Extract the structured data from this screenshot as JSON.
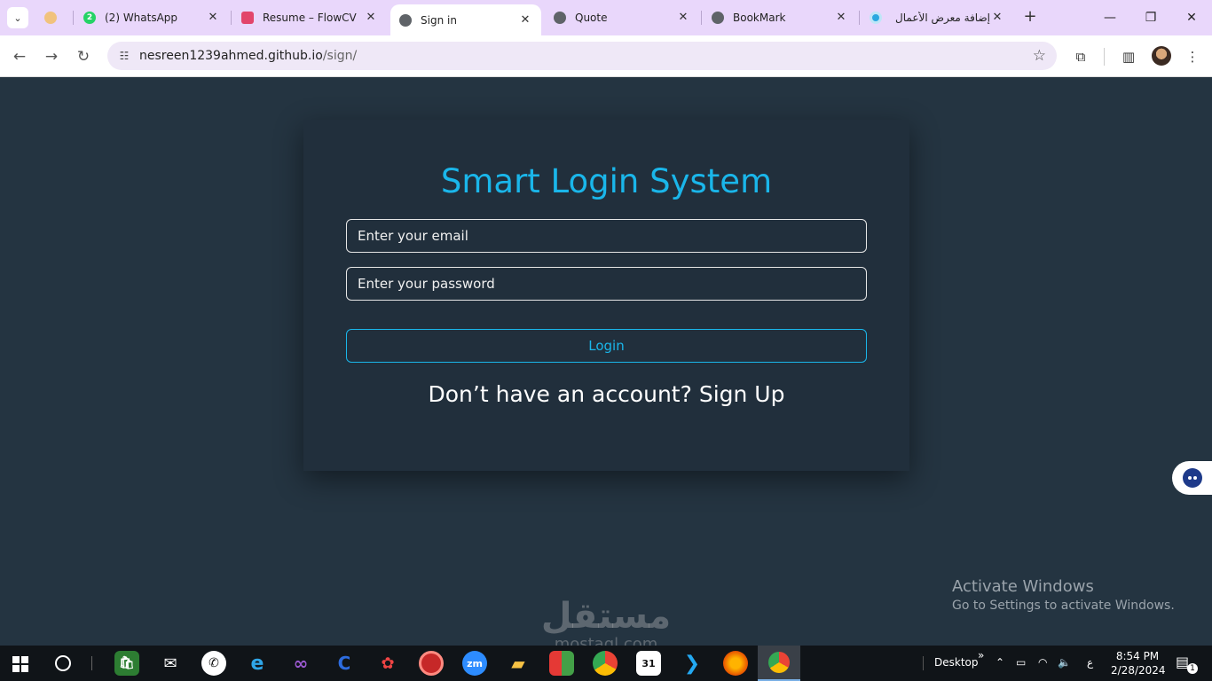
{
  "browser": {
    "tabs": [
      {
        "title": "",
        "favicon": "person-icon",
        "active": false
      },
      {
        "title": "(2) WhatsApp",
        "favicon": "whatsapp-icon",
        "badge": "2",
        "active": false
      },
      {
        "title": "Resume – FlowCV",
        "favicon": "flowcv-icon",
        "active": false
      },
      {
        "title": "Sign in",
        "favicon": "globe-icon",
        "active": true
      },
      {
        "title": "Quote",
        "favicon": "globe-icon",
        "active": false
      },
      {
        "title": "BookMark",
        "favicon": "globe-icon",
        "active": false
      },
      {
        "title": "إضافة معرض الأعمال",
        "favicon": "mostaql-icon",
        "active": false
      }
    ],
    "url_host": "nesreen1239ahmed.github.io",
    "url_path": "/sign/"
  },
  "page": {
    "title": "Smart Login System",
    "email_placeholder": "Enter your email",
    "password_placeholder": "Enter your password",
    "login_label": "Login",
    "signup_prompt": "Don’t have an account?",
    "signup_link": "Sign Up"
  },
  "overlay": {
    "activate_title": "Activate Windows",
    "activate_sub": "Go to Settings to activate Windows.",
    "watermark_ar": "مستقل",
    "watermark_lat": "mostaql.com"
  },
  "taskbar": {
    "desktop_label": "Desktop",
    "lang": "ع",
    "time": "8:54 PM",
    "date": "2/28/2024",
    "notifications": "1",
    "calendar_day": "31",
    "zoom_label": "zm"
  },
  "colors": {
    "page_bg": "#243441",
    "card_bg": "#212f3c",
    "accent": "#1ab6ea",
    "tabstrip": "#e9d7fb"
  }
}
